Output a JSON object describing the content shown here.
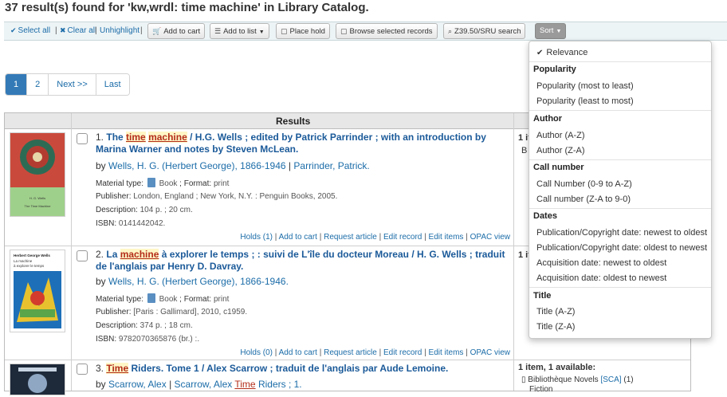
{
  "page_title": "37 result(s) found for 'kw,wrdl: time machine' in Library Catalog.",
  "toolbar": {
    "select_all": "Select all",
    "clear_all": "Clear all",
    "unhighlight": "Unhighlight",
    "add_to_cart": "Add to cart",
    "add_to_list": "Add to list",
    "place_hold": "Place hold",
    "browse_selected": "Browse selected records",
    "z3950": "Z39.50/SRU search",
    "sort": "Sort"
  },
  "pagination": [
    "1",
    "2",
    "Next >>",
    "Last"
  ],
  "table": {
    "header": "Results"
  },
  "results": [
    {
      "num": "1.",
      "title_parts": [
        "The ",
        "time",
        " ",
        "machine",
        " / H.G. Wells ; edited by Patrick Parrinder ; with an introduction by Marina Warner and notes by Steven McLean."
      ],
      "by": "by",
      "author1": "Wells, H. G. (Herbert George), 1866-1946",
      "sep": "|",
      "author2": "Parrinder, Patrick.",
      "material_label": "Material type:",
      "material_value": "Book",
      "format_label": "; Format:",
      "format_value": "print",
      "publisher_label": "Publisher:",
      "publisher_value": "London, England ; New York, N.Y. : Penguin Books, 2005.",
      "description_label": "Description:",
      "description_value": "104 p. ; 20 cm.",
      "isbn_label": "ISBN:",
      "isbn_value": "0141442042.",
      "actions": [
        "Holds (1)",
        "Add to cart",
        "Request article",
        "Edit record",
        "Edit items",
        "OPAC view"
      ],
      "avail_head": "1 it",
      "avail_line1": "B",
      "avail_line2": "F"
    },
    {
      "num": "2.",
      "title_parts": [
        "La ",
        "machine",
        " à explorer le temps ; : suivi de L'île du docteur Moreau / H. G. Wells ; traduit de l'anglais par Henry D. Davray."
      ],
      "by": "by",
      "author1": "Wells, H. G. (Herbert George), 1866-1946.",
      "material_label": "Material type:",
      "material_value": "Book",
      "format_label": "; Format:",
      "format_value": "print",
      "publisher_label": "Publisher:",
      "publisher_value": "[Paris : Gallimard], 2010, c1959.",
      "description_label": "Description:",
      "description_value": "374 p. ; 18 cm.",
      "isbn_label": "ISBN:",
      "isbn_value": "9782070365876 (br.) :.",
      "actions": [
        "Holds (0)",
        "Add to cart",
        "Request article",
        "Edit record",
        "Edit items",
        "OPAC view"
      ],
      "avail_head": "1 it",
      "avail_line1": "B"
    },
    {
      "num": "3.",
      "title_parts": [
        "Time",
        " Riders. Tome 1 / Alex Scarrow ; traduit de l'anglais par Aude Lemoine."
      ],
      "by": "by",
      "author1": "Scarrow, Alex",
      "sep": "|",
      "author2_pre": "Scarrow, Alex",
      "author2_hl": "Time",
      "author2_post": "Riders ; 1.",
      "avail_head": "1 item, 1 available:",
      "avail_lib": "Bibliothèque Novels",
      "avail_code": "[SCA]",
      "avail_count": "(1)",
      "avail_sub": "Fiction"
    }
  ],
  "cover_texts": {
    "c1_author": "H. G. Wells",
    "c1_title": "The Time Machine",
    "c2_author": "Herbert George Wells",
    "c2_title1": "La machine",
    "c2_title2": "à explorer le temps"
  },
  "sort_menu": {
    "relevance": "Relevance",
    "popularity_head": "Popularity",
    "popularity_desc": "Popularity (most to least)",
    "popularity_asc": "Popularity (least to most)",
    "author_head": "Author",
    "author_az": "Author (A-Z)",
    "author_za": "Author (Z-A)",
    "callnumber_head": "Call number",
    "callnumber_09": "Call Number (0-9 to A-Z)",
    "callnumber_za": "Call number (Z-A to 9-0)",
    "dates_head": "Dates",
    "pub_new": "Publication/Copyright date: newest to oldest",
    "pub_old": "Publication/Copyright date: oldest to newest",
    "acq_new": "Acquisition date: newest to oldest",
    "acq_old": "Acquisition date: oldest to newest",
    "title_head": "Title",
    "title_az": "Title (A-Z)",
    "title_za": "Title (Z-A)"
  },
  "colors": {
    "link": "#1b6ca8",
    "highlight_text": "#b32d1a",
    "active_page": "#337ab7",
    "toolbar_bg": "#edf4f6"
  }
}
